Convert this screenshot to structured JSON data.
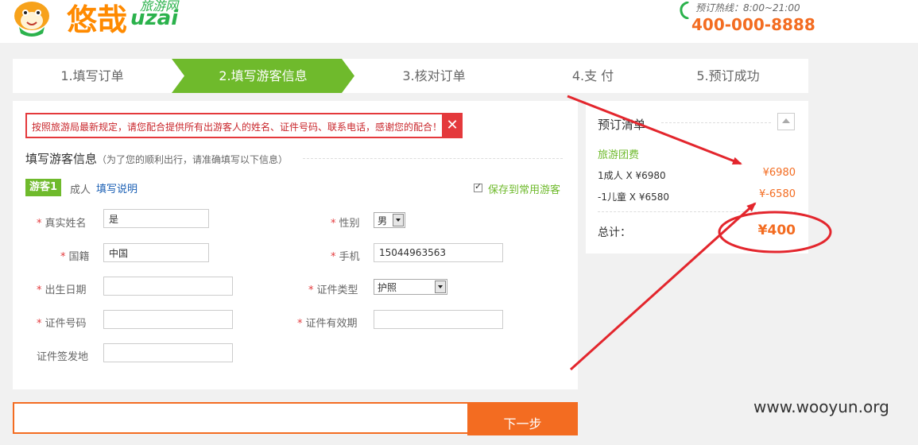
{
  "header": {
    "brand_cn": "悠哉",
    "brand_sub": "旅游网",
    "brand_en": "uzai",
    "hotline_label": "预订热线：8:00~21:00",
    "hotline_number": "400-000-8888"
  },
  "steps": [
    {
      "label": "1.填写订单"
    },
    {
      "label": "2.填写游客信息"
    },
    {
      "label": "3.核对订单"
    },
    {
      "label": "4.支 付"
    },
    {
      "label": "5.预订成功"
    }
  ],
  "notice": {
    "text": "按照旅游局最新规定，请您配合提供所有出游客人的姓名、证件号码、联系电话，感谢您的配合！",
    "close": "✕"
  },
  "section": {
    "title": "填写游客信息",
    "subtitle": "（为了您的顺利出行，请准确填写以下信息）"
  },
  "tourist": {
    "tag": "游客1",
    "type": "成人",
    "help": "填写说明",
    "save_label": "保存到常用游客"
  },
  "form": {
    "name_label": "真实姓名",
    "name_value": "是",
    "gender_label": "性别",
    "gender_value": "男",
    "nationality_label": "国籍",
    "nationality_value": "中国",
    "phone_label": "手机",
    "phone_value": "15044963563",
    "birth_label": "出生日期",
    "birth_value": "",
    "id_type_label": "证件类型",
    "id_type_value": "护照",
    "id_number_label": "证件号码",
    "id_number_value": "",
    "id_expiry_label": "证件有效期",
    "id_expiry_value": "",
    "id_issue_label": "证件签发地",
    "id_issue_value": "",
    "required_mark": "*"
  },
  "submit": {
    "next_label": "下一步"
  },
  "summary": {
    "title": "预订清单",
    "group": "旅游团费",
    "rows": [
      {
        "label": "1成人  X  ¥6980",
        "amount": "¥6980"
      },
      {
        "label": "-1儿童  X  ¥6580",
        "amount": "¥-6580"
      }
    ],
    "total_label": "总计：",
    "total_amount": "¥400"
  },
  "watermark": "www.wooyun.org",
  "colors": {
    "accent_green": "#6fba2c",
    "accent_orange": "#f36c21",
    "alert_red": "#e4393c",
    "annotation_red": "#e3262d"
  }
}
